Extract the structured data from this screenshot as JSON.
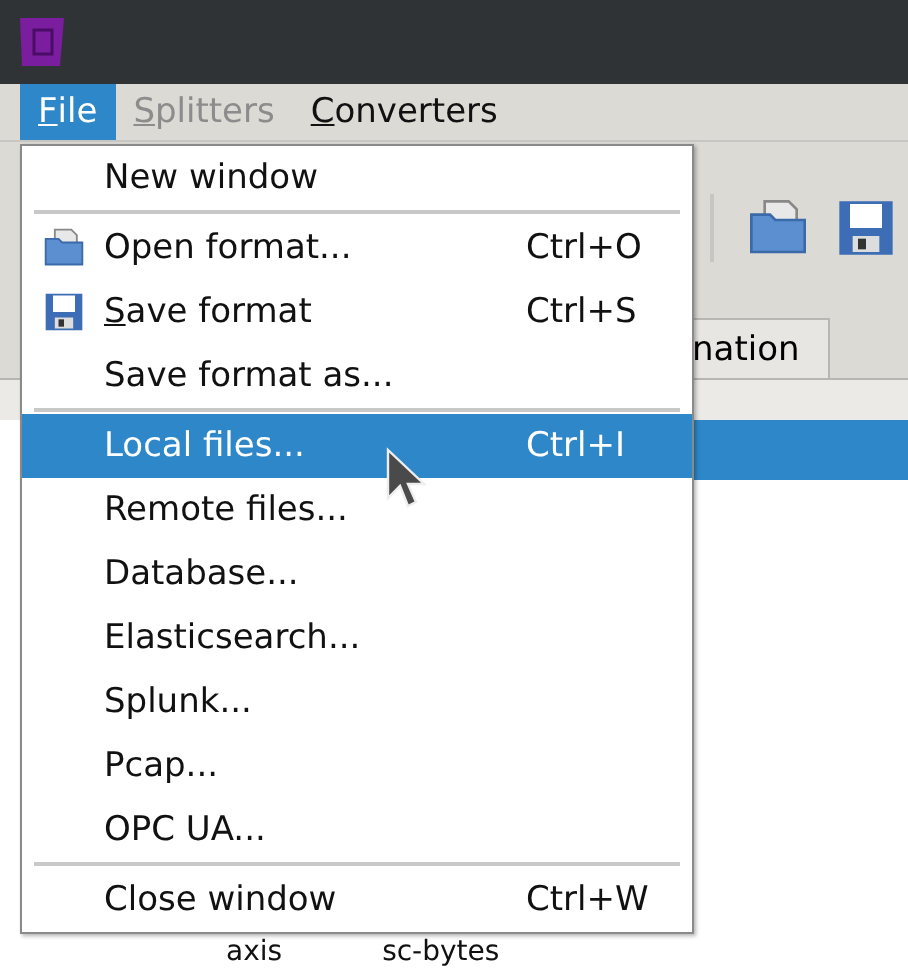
{
  "menubar": [
    {
      "label": "File",
      "mnemonic_first": true,
      "disabled": false,
      "selected": true
    },
    {
      "label": "Splitters",
      "mnemonic_first": true,
      "disabled": true,
      "selected": false
    },
    {
      "label": "Converters",
      "mnemonic_first": true,
      "disabled": false,
      "selected": false
    }
  ],
  "tab": {
    "label": "nation"
  },
  "table": {
    "columns": [
      "axis",
      "sc-bytes"
    ]
  },
  "menu": [
    {
      "kind": "item",
      "label": "New window",
      "mnemonic_first": false,
      "selected": false
    },
    {
      "kind": "separator"
    },
    {
      "kind": "folder_item",
      "label": "Open format...",
      "shortcut": "Ctrl+O",
      "mnemonic_first": false,
      "selected": false
    },
    {
      "kind": "floppy_item",
      "label": "Save format",
      "shortcut": "Ctrl+S",
      "mnemonic_first": true,
      "selected": false
    },
    {
      "kind": "item",
      "label": "Save format as...",
      "mnemonic_first": false,
      "selected": false
    },
    {
      "kind": "separator"
    },
    {
      "kind": "item",
      "label": "Local files...",
      "shortcut": "Ctrl+I",
      "mnemonic_first": false,
      "selected": true
    },
    {
      "kind": "item",
      "label": "Remote files...",
      "mnemonic_first": false,
      "selected": false
    },
    {
      "kind": "item",
      "label": "Database...",
      "mnemonic_first": false,
      "selected": false
    },
    {
      "kind": "item",
      "label": "Elasticsearch...",
      "mnemonic_first": false,
      "selected": false
    },
    {
      "kind": "item",
      "label": "Splunk...",
      "mnemonic_first": false,
      "selected": false
    },
    {
      "kind": "item",
      "label": "Pcap...",
      "mnemonic_first": false,
      "selected": false
    },
    {
      "kind": "item",
      "label": "OPC UA...",
      "mnemonic_first": false,
      "selected": false
    },
    {
      "kind": "separator"
    },
    {
      "kind": "item",
      "label": "Close window",
      "shortcut": "Ctrl+W",
      "mnemonic_first": false,
      "selected": false
    }
  ]
}
